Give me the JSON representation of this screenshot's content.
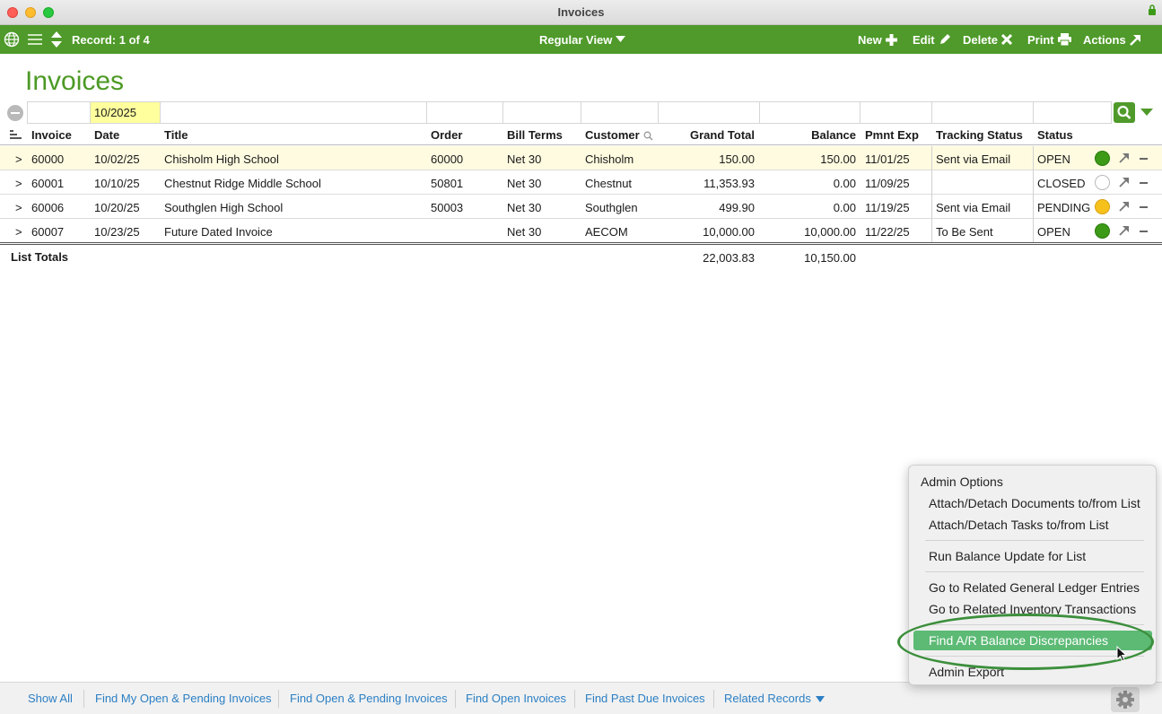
{
  "window": {
    "title": "Invoices"
  },
  "toolbar": {
    "record_label": "Record: 1 of 4",
    "view_label": "Regular View",
    "new_label": "New",
    "edit_label": "Edit",
    "delete_label": "Delete",
    "print_label": "Print",
    "actions_label": "Actions",
    "color": "#4f9a2a"
  },
  "page": {
    "title": "Invoices"
  },
  "find": {
    "date_value": "10/2025"
  },
  "columns": {
    "invoice": "Invoice",
    "date": "Date",
    "title": "Title",
    "order": "Order",
    "bill_terms": "Bill Terms",
    "customer": "Customer",
    "grand_total": "Grand Total",
    "balance": "Balance",
    "pmnt_exp": "Pmnt Exp",
    "tracking_status": "Tracking Status",
    "status": "Status"
  },
  "rows": [
    {
      "arrow": ">",
      "invoice": "60000",
      "date": "10/02/25",
      "title": "Chisholm High School",
      "order": "60000",
      "bill_terms": "Net 30",
      "customer": "Chisholm",
      "grand_total": "150.00",
      "balance": "150.00",
      "pmnt_exp": "11/01/25",
      "tracking_status": "Sent via Email",
      "status": "OPEN",
      "indicator": "open"
    },
    {
      "arrow": ">",
      "invoice": "60001",
      "date": "10/10/25",
      "title": "Chestnut Ridge Middle School",
      "order": "50801",
      "bill_terms": "Net 30",
      "customer": "Chestnut",
      "grand_total": "11,353.93",
      "balance": "0.00",
      "pmnt_exp": "11/09/25",
      "tracking_status": "",
      "status": "CLOSED",
      "indicator": "closed"
    },
    {
      "arrow": ">",
      "invoice": "60006",
      "date": "10/20/25",
      "title": "Southglen High School",
      "order": "50003",
      "bill_terms": "Net 30",
      "customer": "Southglen",
      "grand_total": "499.90",
      "balance": "0.00",
      "pmnt_exp": "11/19/25",
      "tracking_status": "Sent via Email",
      "status": "PENDING",
      "indicator": "pending"
    },
    {
      "arrow": ">",
      "invoice": "60007",
      "date": "10/23/25",
      "title": "Future Dated Invoice",
      "order": "",
      "bill_terms": "Net 30",
      "customer": "AECOM",
      "grand_total": "10,000.00",
      "balance": "10,000.00",
      "pmnt_exp": "11/22/25",
      "tracking_status": "To Be Sent",
      "status": "OPEN",
      "indicator": "open"
    }
  ],
  "totals": {
    "label": "List Totals",
    "grand_total": "22,003.83",
    "balance": "10,150.00"
  },
  "menu": {
    "heading": "Admin Options",
    "items": [
      "Attach/Detach Documents to/from List",
      "Attach/Detach Tasks to/from List",
      "Run Balance Update for List",
      "Go to Related General Ledger Entries",
      "Go to Related Inventory Transactions",
      "Find A/R Balance Discrepancies",
      "Admin Export"
    ],
    "active_item": "Find A/R Balance Discrepancies"
  },
  "footer": {
    "links": [
      "Show All",
      "Find My Open & Pending Invoices",
      "Find Open & Pending Invoices",
      "Find Open Invoices",
      "Find Past Due Invoices",
      "Related Records"
    ]
  },
  "icons": [
    "globe-icon",
    "list-icon",
    "sort-arrows-icon",
    "plus-icon",
    "pencil-icon",
    "x-icon",
    "printer-icon",
    "jump-arrow-icon",
    "search-icon",
    "gear-icon",
    "lock-icon"
  ]
}
